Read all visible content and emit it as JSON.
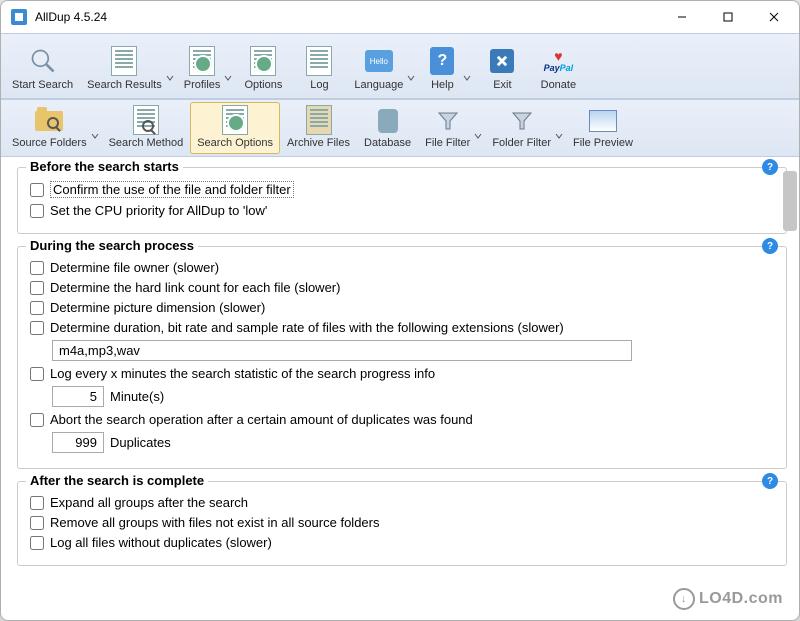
{
  "window": {
    "title": "AllDup 4.5.24"
  },
  "toolbar1": [
    {
      "id": "start-search",
      "label": "Start Search",
      "icon": "magnifier"
    },
    {
      "id": "search-results",
      "label": "Search Results",
      "icon": "doc-mag",
      "drop": true
    },
    {
      "id": "profiles",
      "label": "Profiles",
      "icon": "doc-gear",
      "drop": true
    },
    {
      "id": "options",
      "label": "Options",
      "icon": "doc-gear"
    },
    {
      "id": "log",
      "label": "Log",
      "icon": "doc"
    },
    {
      "id": "language",
      "label": "Language",
      "icon": "hello",
      "drop": true
    },
    {
      "id": "help",
      "label": "Help",
      "icon": "help",
      "drop": true
    },
    {
      "id": "exit",
      "label": "Exit",
      "icon": "exit"
    },
    {
      "id": "donate",
      "label": "Donate",
      "icon": "paypal"
    }
  ],
  "toolbar2": [
    {
      "id": "source-folders",
      "label": "Source Folders",
      "icon": "folder-mag",
      "drop": true
    },
    {
      "id": "search-method",
      "label": "Search Method",
      "icon": "doc-mag"
    },
    {
      "id": "search-options",
      "label": "Search Options",
      "icon": "doc-gear",
      "active": true
    },
    {
      "id": "archive-files",
      "label": "Archive Files",
      "icon": "archive"
    },
    {
      "id": "database",
      "label": "Database",
      "icon": "database"
    },
    {
      "id": "file-filter",
      "label": "File Filter",
      "icon": "funnel",
      "drop": true
    },
    {
      "id": "folder-filter",
      "label": "Folder Filter",
      "icon": "funnel",
      "drop": true
    },
    {
      "id": "file-preview",
      "label": "File Preview",
      "icon": "preview"
    }
  ],
  "sections": {
    "before": {
      "title": "Before the search starts",
      "items": [
        {
          "label": "Confirm the use of the file and folder filter",
          "boxed": true
        },
        {
          "label": "Set the CPU priority for AllDup to 'low'"
        }
      ]
    },
    "during": {
      "title": "During the search process",
      "items": [
        {
          "label": "Determine file owner (slower)"
        },
        {
          "label": "Determine the hard link count for each file (slower)"
        },
        {
          "label": "Determine picture dimension (slower)"
        },
        {
          "label": "Determine duration, bit rate and sample rate of files with the following extensions (slower)"
        }
      ],
      "extensions_value": "m4a,mp3,wav",
      "log_label": "Log every x minutes the search statistic of the search progress info",
      "log_value": "5",
      "log_unit": "Minute(s)",
      "abort_label": "Abort the search operation after a certain amount of duplicates was found",
      "abort_value": "999",
      "abort_unit": "Duplicates"
    },
    "after": {
      "title": "After the search is complete",
      "items": [
        {
          "label": "Expand all groups after the search"
        },
        {
          "label": "Remove all groups with files not exist in all source folders"
        },
        {
          "label": "Log all files without duplicates (slower)"
        }
      ]
    }
  },
  "watermark": "LO4D.com"
}
